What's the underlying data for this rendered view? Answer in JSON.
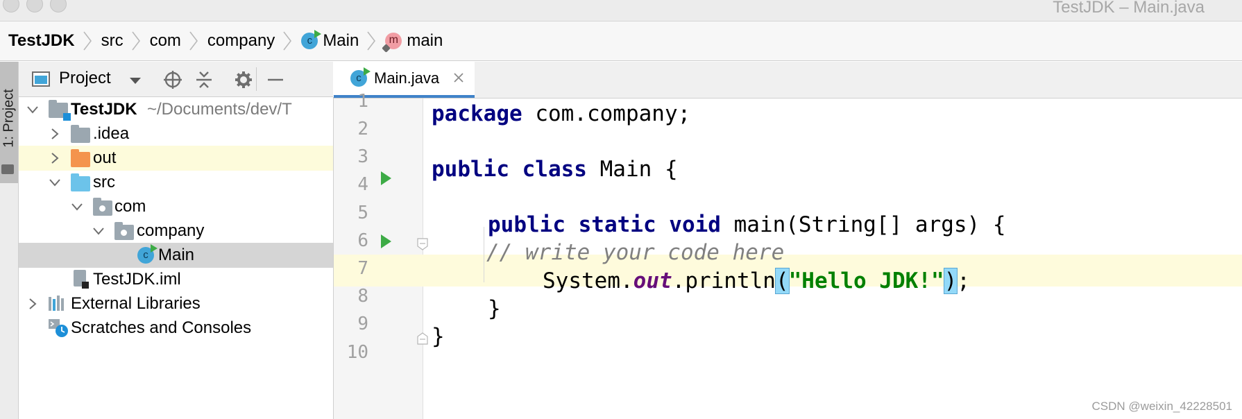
{
  "window": {
    "title": "TestJDK – Main.java"
  },
  "breadcrumb": [
    {
      "label": "TestJDK",
      "icon": "none"
    },
    {
      "label": "src",
      "icon": "none"
    },
    {
      "label": "com",
      "icon": "none"
    },
    {
      "label": "company",
      "icon": "none"
    },
    {
      "label": "Main",
      "icon": "class-icon"
    },
    {
      "label": "main",
      "icon": "method-icon"
    }
  ],
  "tool_stripe": {
    "label": "1: Project"
  },
  "project_panel": {
    "title": "Project",
    "tree": [
      {
        "label": "TestJDK",
        "suffix": "~/Documents/dev/T",
        "icon": "module-icon",
        "expanded": true
      },
      {
        "label": ".idea",
        "icon": "folder-icon"
      },
      {
        "label": "out",
        "icon": "excluded-folder-icon"
      },
      {
        "label": "src",
        "icon": "source-folder-icon"
      },
      {
        "label": "com",
        "icon": "package-icon"
      },
      {
        "label": "company",
        "icon": "package-icon"
      },
      {
        "label": "Main",
        "icon": "class-icon"
      },
      {
        "label": "TestJDK.iml",
        "icon": "iml-file-icon"
      },
      {
        "label": "External Libraries",
        "icon": "libraries-icon"
      },
      {
        "label": "Scratches and Consoles",
        "icon": "scratches-icon"
      }
    ]
  },
  "editor": {
    "tab": {
      "label": "Main.java"
    },
    "line_numbers": [
      "1",
      "2",
      "3",
      "4",
      "5",
      "6",
      "7",
      "8",
      "9",
      "10"
    ],
    "code": {
      "l1_kw": "package",
      "l1_rest": " com.company;",
      "l3_kw": "public class",
      "l3_rest": " Main {",
      "l5_kw": "public static void",
      "l5_rest": " main(String[] args) {",
      "l6_comment": "// write your code here",
      "l7_a": "System.",
      "l7_field": "out",
      "l7_b": ".println",
      "l7_open": "(",
      "l7_str": "\"Hello JDK!\"",
      "l7_close": ")",
      "l7_end": ";",
      "l8": "}",
      "l9": "}"
    }
  },
  "watermark": "CSDN @weixin_42228501",
  "colors": {
    "keyword": "#000080",
    "string": "#008000",
    "field": "#660e7a",
    "comment": "#808080",
    "accent": "#4083c9"
  }
}
